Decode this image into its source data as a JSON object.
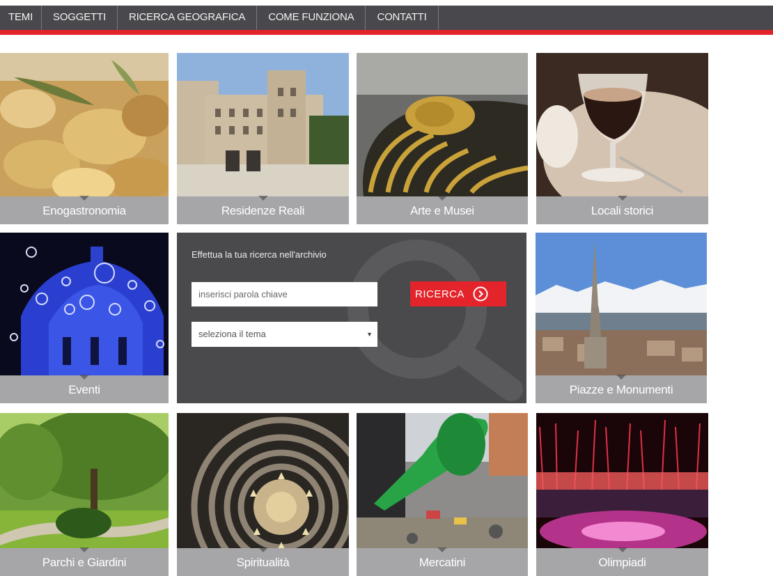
{
  "nav": {
    "items": [
      "TEMI",
      "SOGGETTI",
      "RICERCA GEOGRAFICA",
      "COME FUNZIONA",
      "CONTATTI"
    ]
  },
  "tiles": [
    {
      "label": "Enogastronomia",
      "icon": "pasta-photo"
    },
    {
      "label": "Residenze Reali",
      "icon": "palace-photo"
    },
    {
      "label": "Arte e Musei",
      "icon": "sarcophagus-photo"
    },
    {
      "label": "Locali storici",
      "icon": "coffee-photo"
    },
    {
      "label": "Eventi",
      "icon": "illuminated-dome-photo"
    },
    {
      "label": "Piazze e Monumenti",
      "icon": "mole-antonelliana-photo"
    },
    {
      "label": "Parchi e Giardini",
      "icon": "park-photo"
    },
    {
      "label": "Spiritualità",
      "icon": "dome-interior-photo"
    },
    {
      "label": "Mercatini",
      "icon": "flea-market-photo"
    },
    {
      "label": "Olimpiadi",
      "icon": "fireworks-photo"
    }
  ],
  "search": {
    "title": "Effettua la tua ricerca nell'archivio",
    "keyword_placeholder": "inserisci parola chiave",
    "theme_select": "seleziona il tema",
    "button_label": "RICERCA"
  },
  "colors": {
    "nav_bg": "#49494d",
    "accent_red": "#e2242a",
    "caption_bg": "#a6a6a9",
    "panel_bg": "#4a4a4c"
  }
}
